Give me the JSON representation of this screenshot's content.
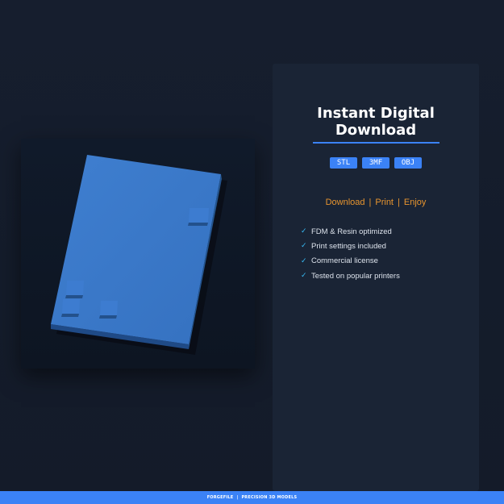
{
  "product": {
    "title_line1": "Instant Digital",
    "title_line2": "Download",
    "formats": [
      "STL",
      "3MF",
      "OBJ"
    ],
    "tagline": [
      "Download",
      "Print",
      "Enjoy"
    ],
    "features": [
      "FDM & Resin optimized",
      "Print settings included",
      "Commercial license",
      "Tested on popular printers"
    ]
  },
  "footer": {
    "brand": "FORGEFILE",
    "subtitle": "PRECISION 3D MODELS"
  },
  "colors": {
    "accent": "#3b82f6",
    "tagline": "#e8952f",
    "check": "#38bdf8",
    "panel": "#1a2435",
    "background": "#151d2c"
  },
  "icons": {
    "check": "check-icon"
  }
}
